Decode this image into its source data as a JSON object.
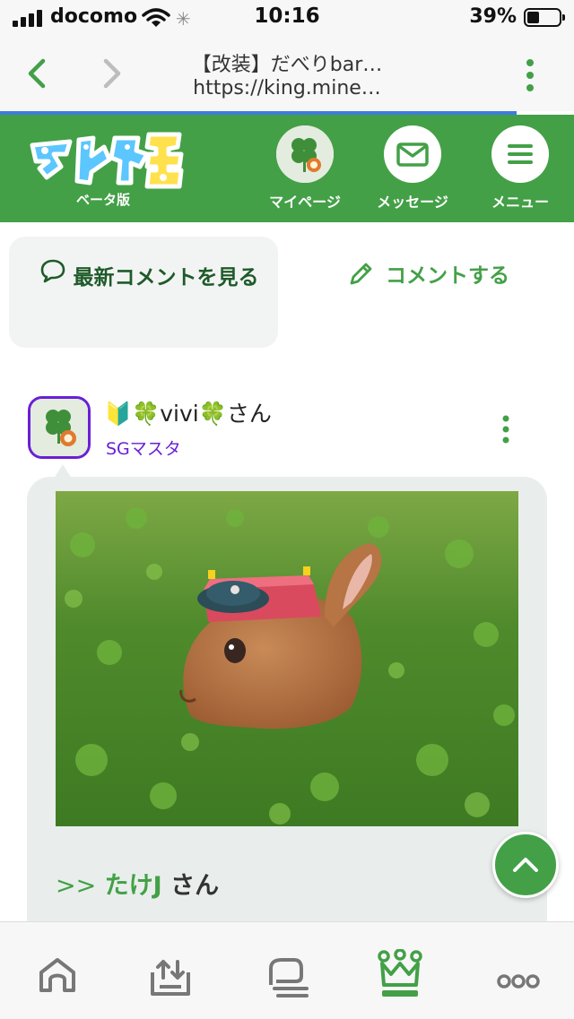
{
  "status_bar": {
    "carrier": "docomo",
    "time": "10:16",
    "battery": "39%"
  },
  "browser": {
    "page_title": "【改装】だべりbar…",
    "url": "https://king.mine…",
    "icons": [
      "chevron-left-icon",
      "chevron-right-icon",
      "more-vertical-icon"
    ]
  },
  "header": {
    "logo_sub": "ベータ版",
    "mypage_label": "マイページ",
    "message_label": "メッセージ",
    "menu_label": "メニュー",
    "colors": {
      "brand": "#43a047",
      "progress": "#3e7ce0"
    }
  },
  "actions": {
    "latest_label": "最新コメントを見る",
    "comment_label": "コメントする"
  },
  "post": {
    "user_prefix": "🔰🍀",
    "user_name": "vivi",
    "user_suffix": "🍀さん",
    "badge": "SGマスタ",
    "reply_arrow": ">>",
    "reply_name": "たけJ",
    "reply_suffix": "さん",
    "accent": "#6a1fd6"
  },
  "bottom_nav": {
    "items": [
      "home-icon",
      "upload-icon",
      "threads-icon",
      "crown-icon",
      "more-horizontal-icon"
    ],
    "active": "crown-icon"
  }
}
